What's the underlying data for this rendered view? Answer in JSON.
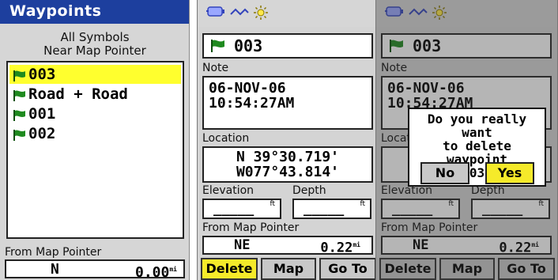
{
  "waypoints_list": {
    "title": "Waypoints",
    "filter_line1": "All Symbols",
    "filter_line2": "Near Map Pointer",
    "items": [
      {
        "name": "003",
        "selected": true
      },
      {
        "name": "Road + Road",
        "selected": false
      },
      {
        "name": "001",
        "selected": false
      },
      {
        "name": "002",
        "selected": false
      }
    ],
    "from_label": "From Map Pointer",
    "from_direction": "N",
    "from_distance": "0.00",
    "from_unit": "mi"
  },
  "waypoint_detail": {
    "name": "003",
    "note_label": "Note",
    "note_line1": "06-NOV-06",
    "note_line2": "10:54:27AM",
    "location_label": "Location",
    "location_lat": "N  39°30.719'",
    "location_lon": "W077°43.814'",
    "elevation_label": "Elevation",
    "depth_label": "Depth",
    "elevation_value": "_____",
    "depth_value": "_____",
    "unit_ft": "ft",
    "from_label": "From Map Pointer",
    "from_direction": "NE",
    "from_distance": "0.22",
    "from_unit": "mi",
    "buttons": {
      "delete": "Delete",
      "map": "Map",
      "goto": "Go To"
    }
  },
  "confirm_dialog": {
    "line1": "Do you really want",
    "line2": "to delete waypoint",
    "line3": "003?",
    "no": "No",
    "yes": "Yes"
  },
  "colors": {
    "title_bar": "#1d3f9e",
    "highlight": "#ffff2e",
    "button_active": "#f5ea2a",
    "flag": "#1e8a1e",
    "panel_bg": "#d4d4d4"
  },
  "icons": [
    "flag-icon",
    "battery-icon",
    "satellite-signal-icon",
    "backlight-icon"
  ]
}
